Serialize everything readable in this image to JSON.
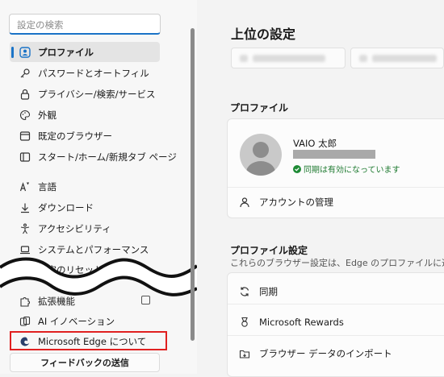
{
  "sidebar": {
    "search_placeholder": "設定の検索",
    "items": [
      {
        "label": "プロファイル",
        "icon": "profile-icon"
      },
      {
        "label": "パスワードとオートフィル",
        "icon": "key-icon"
      },
      {
        "label": "プライバシー/検索/サービス",
        "icon": "lock-icon"
      },
      {
        "label": "外観",
        "icon": "palette-icon"
      },
      {
        "label": "既定のブラウザー",
        "icon": "browser-icon"
      },
      {
        "label": "スタート/ホーム/新規タブ ページ",
        "icon": "home-icon"
      },
      {
        "label": "言語",
        "icon": "language-icon"
      },
      {
        "label": "ダウンロード",
        "icon": "download-icon"
      },
      {
        "label": "アクセシビリティ",
        "icon": "accessibility-icon"
      },
      {
        "label": "システムとパフォーマンス",
        "icon": "laptop-icon"
      },
      {
        "label": "設定のリセット",
        "icon": "reset-icon"
      },
      {
        "label": "拡張機能",
        "icon": "extension-icon"
      },
      {
        "label": "AI イノベーション",
        "icon": "ai-icon"
      },
      {
        "label": "Microsoft Edge について",
        "icon": "edge-icon"
      }
    ],
    "feedback_label": "フィードバックの送信"
  },
  "main": {
    "title": "上位の設定",
    "profile_section_title": "プロファイル",
    "profile": {
      "name": "VAIO 太郎",
      "sync_status": "同期は有効になっています",
      "manage_account": "アカウントの管理"
    },
    "profile_settings_title": "プロファイル設定",
    "profile_settings_sub": "これらのブラウザー設定は、Edge のプロファイルに適",
    "settings_rows": [
      {
        "label": "同期",
        "icon": "sync-icon"
      },
      {
        "label": "Microsoft Rewards",
        "icon": "rewards-icon"
      },
      {
        "label": "ブラウザー データのインポート",
        "icon": "import-icon"
      }
    ]
  },
  "colors": {
    "accent": "#1a73c7",
    "highlight": "#e02020",
    "sync_green": "#1e8a35"
  }
}
